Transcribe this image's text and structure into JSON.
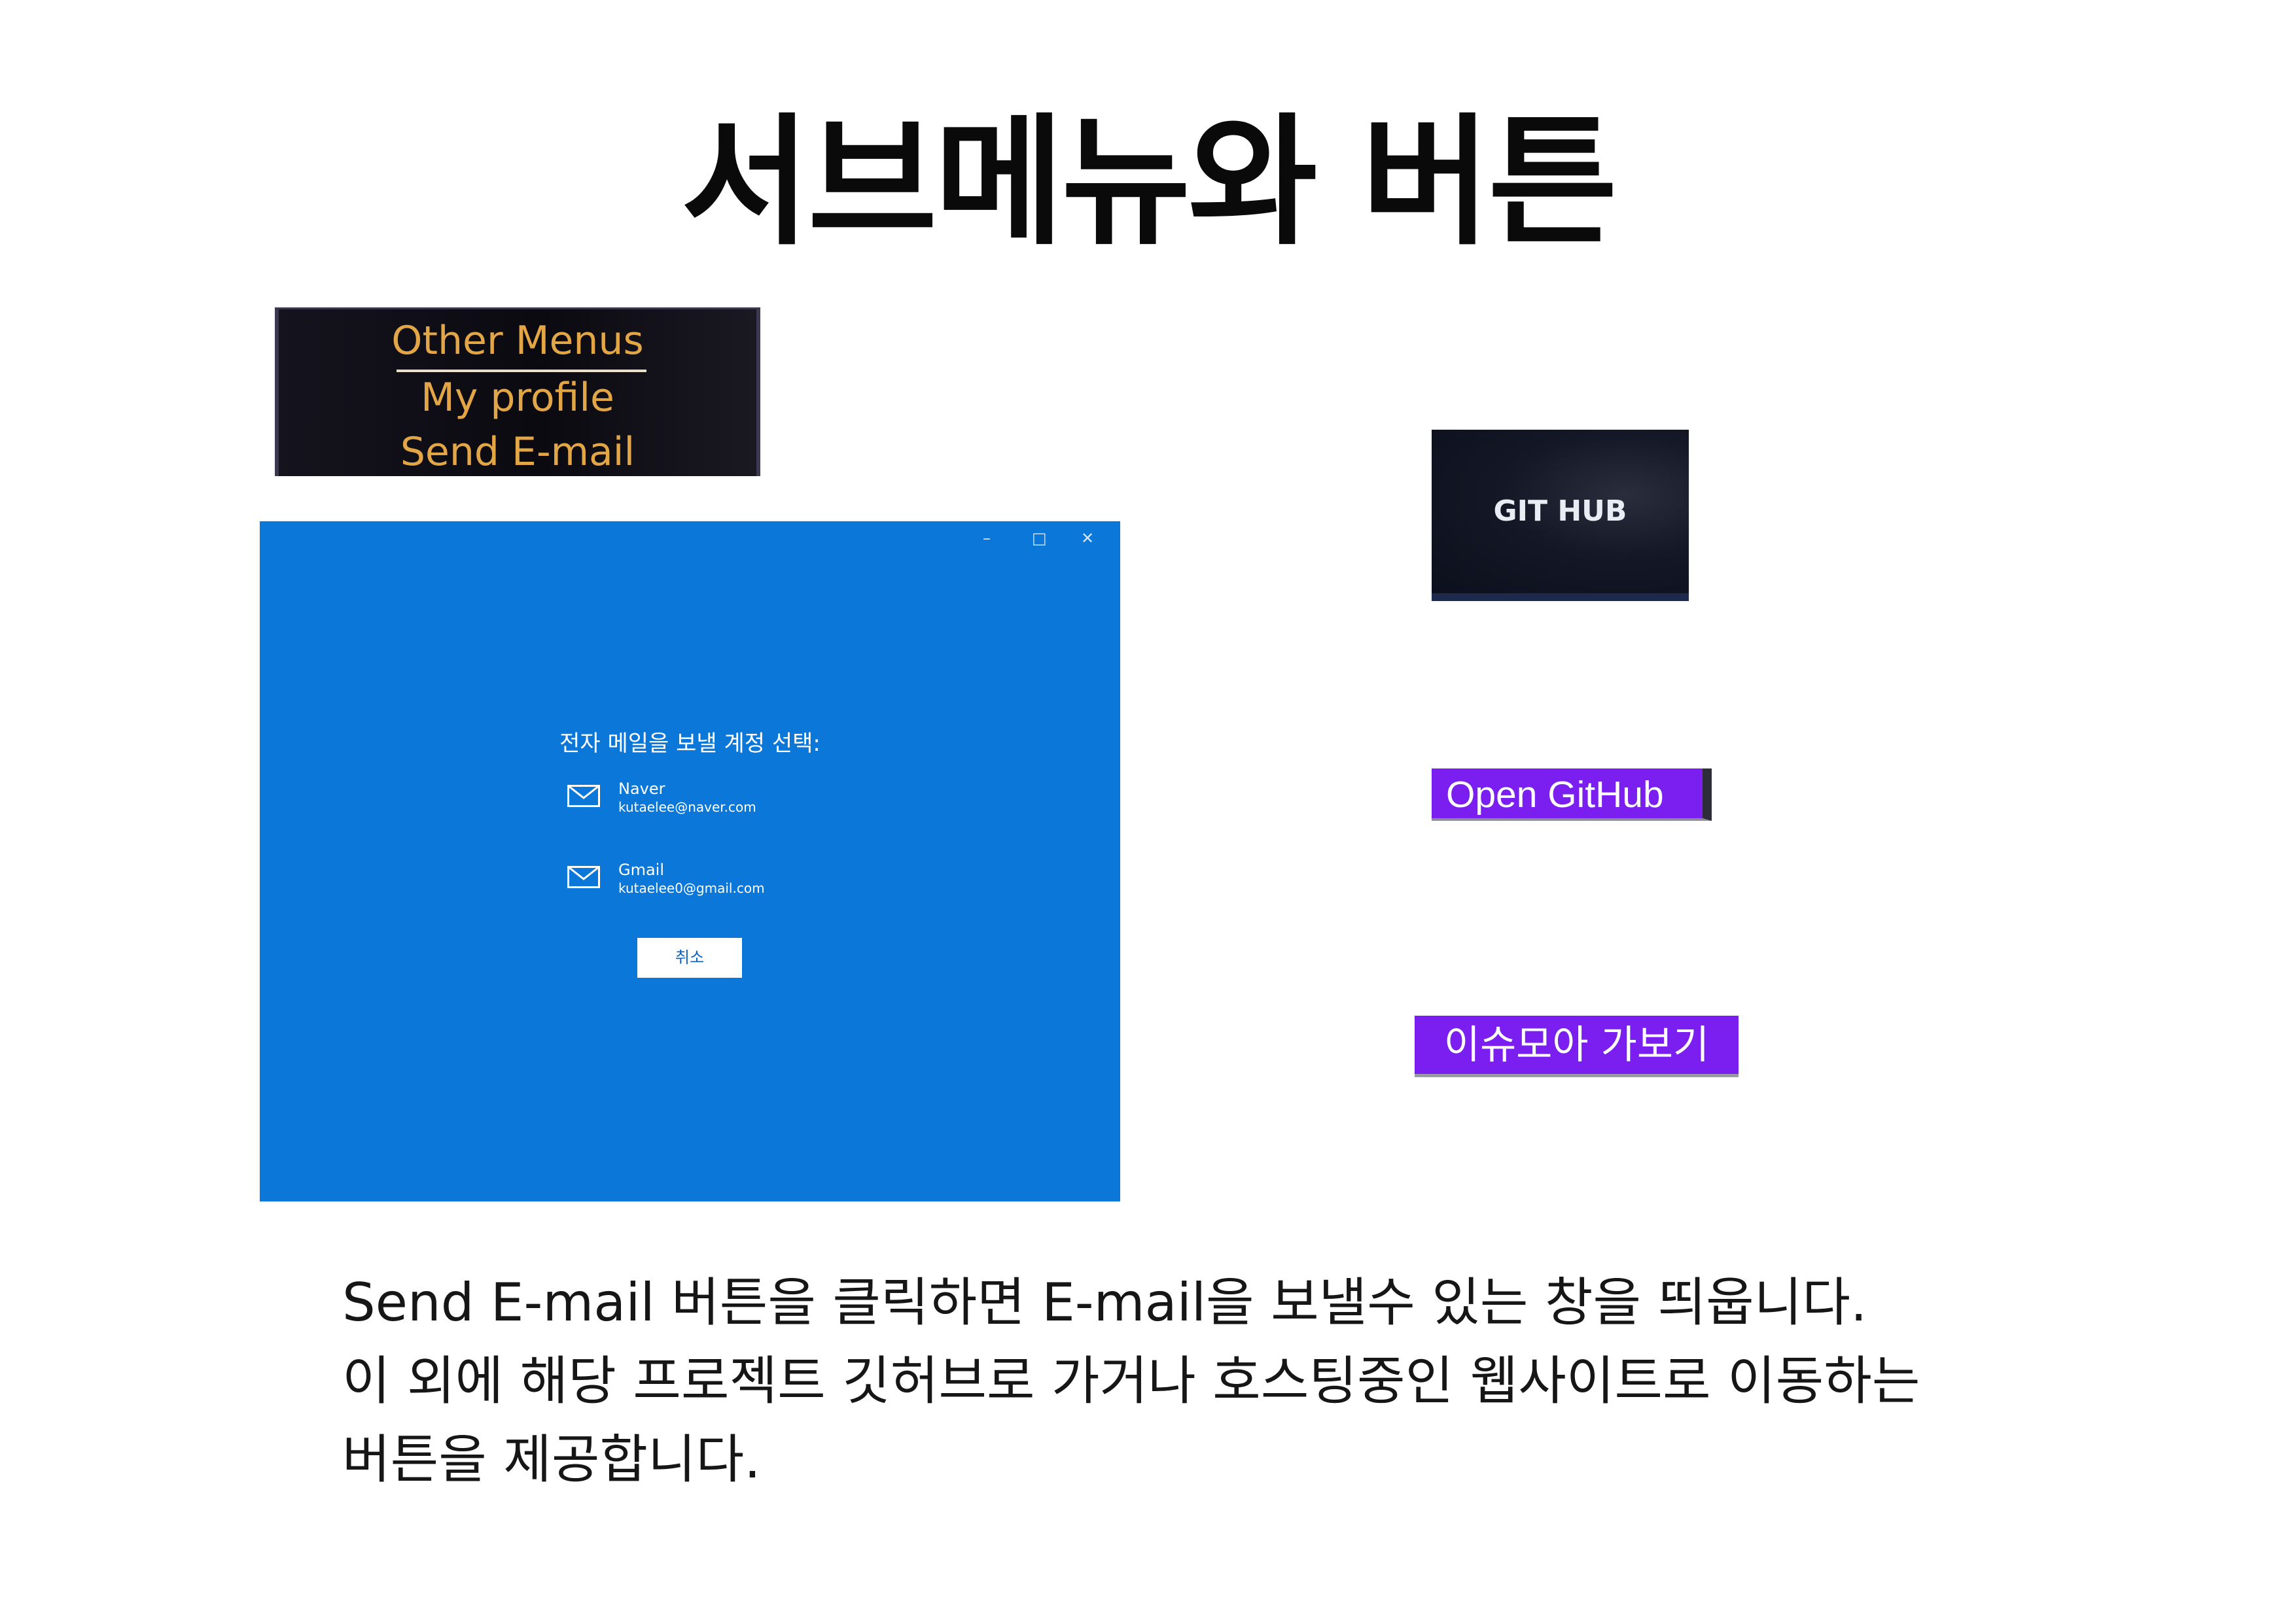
{
  "page": {
    "title": "서브메뉴와 버튼"
  },
  "submenu": {
    "items": [
      "Other Menus",
      "My profile",
      "Send E-mail"
    ],
    "text_color": "#e3a647"
  },
  "mail_window": {
    "controls": {
      "minimize": "–",
      "maximize": "□",
      "close": "✕"
    },
    "heading": "전자 메일을 보낼 계정 선택:",
    "accounts": [
      {
        "name": "Naver",
        "email": "kutaelee@naver.com",
        "icon": "mail-icon"
      },
      {
        "name": "Gmail",
        "email": "kutaelee0@gmail.com",
        "icon": "mail-icon"
      }
    ],
    "cancel_label": "취소",
    "background": "#0a77d9"
  },
  "buttons": {
    "git_hub": "GIT HUB",
    "open_github": "Open GitHub",
    "issuemoa": "이슈모아 가보기",
    "accent": "#7a1ff0"
  },
  "description": {
    "lines": [
      "Send E-mail 버튼을 클릭하면 E-mail을 보낼수 있는 창을 띄웁니다.",
      "이 외에 해당 프로젝트 깃허브로 가거나 호스팅중인 웹사이트로 이동하는",
      "버튼을 제공합니다."
    ]
  }
}
